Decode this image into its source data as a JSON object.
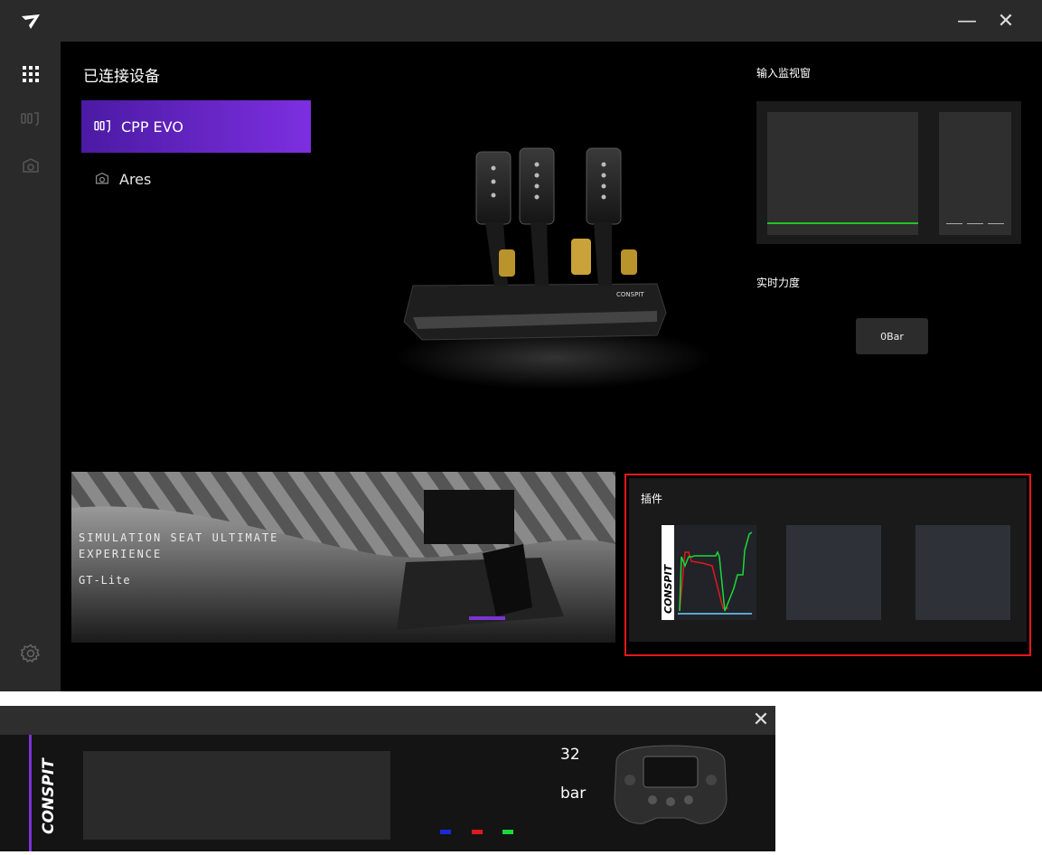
{
  "window": {
    "minimize_label": "—",
    "close_label": "✕"
  },
  "sidebar": {
    "items": [
      {
        "icon": "apps-grid-icon"
      },
      {
        "icon": "pedals-icon"
      },
      {
        "icon": "wheel-base-icon"
      },
      {
        "icon": "settings-gear-icon"
      }
    ]
  },
  "devices": {
    "title": "已连接设备",
    "items": [
      {
        "label": "CPP EVO",
        "icon": "pedals-icon",
        "selected": true
      },
      {
        "label": "Ares",
        "icon": "wheel-base-icon",
        "selected": false
      }
    ]
  },
  "monitor": {
    "title": "输入监视窗",
    "colors": {
      "active_line": "#22c322"
    }
  },
  "force": {
    "title": "实时力度",
    "value": "0Bar"
  },
  "banner": {
    "line1": "SIMULATION SEAT  ULTIMATE EXPERIENCE",
    "line2": "GT-Lite"
  },
  "plugins": {
    "title": "插件",
    "highlight_color": "#e8161d"
  },
  "widget": {
    "close_label": "✕",
    "value": "32",
    "unit": "bar",
    "dot_colors": [
      "#1a2ad8",
      "#e01a1a",
      "#1ad83a"
    ],
    "accent": "#7b33d6"
  }
}
